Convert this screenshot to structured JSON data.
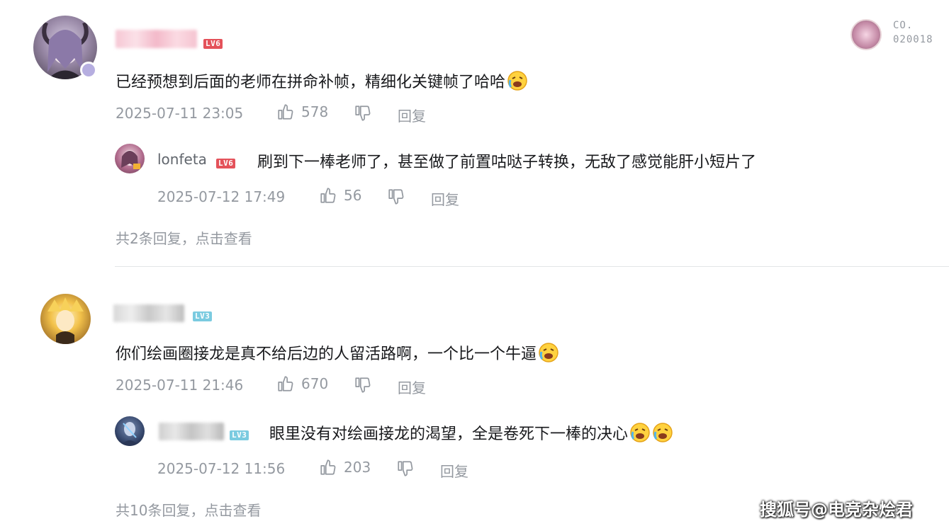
{
  "comments": [
    {
      "level": "LV6",
      "level_color": "#e4525a",
      "text": "已经预想到后面的老师在拼命补帧，精细化关键帧了哈哈",
      "time": "2025-07-11 23:05",
      "likes": "578",
      "reply_label": "回复",
      "badge": {
        "line1": "CO.",
        "line2": "020018"
      },
      "replies": [
        {
          "username": "lonfeta",
          "level": "LV6",
          "level_color": "#e4525a",
          "text": "刷到下一棒老师了，甚至做了前置咕哒子转换，无敌了感觉能肝小短片了",
          "time": "2025-07-12 17:49",
          "likes": "56",
          "reply_label": "回复"
        }
      ],
      "more_replies": "共2条回复，点击查看"
    },
    {
      "level": "LV3",
      "level_color": "#7bcbe0",
      "text": "你们绘画圈接龙是真不给后边的人留活路啊，一个比一个牛逼",
      "time": "2025-07-11 21:46",
      "likes": "670",
      "reply_label": "回复",
      "replies": [
        {
          "username": "",
          "level": "LV3",
          "level_color": "#7bcbe0",
          "text": "眼里没有对绘画接龙的渴望，全是卷死下一棒的决心",
          "time": "2025-07-12 11:56",
          "likes": "203",
          "reply_label": "回复"
        }
      ],
      "more_replies": "共10条回复，点击查看"
    }
  ],
  "watermark": "搜狐号@电竞杂烩君",
  "icons": {
    "like": "thumbs-up-icon",
    "dislike": "thumbs-down-icon",
    "emoji": "laughing-crying-emoji-icon"
  }
}
